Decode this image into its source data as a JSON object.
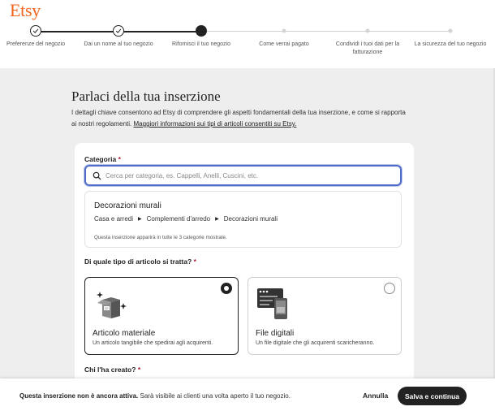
{
  "brand": {
    "logo": "Etsy",
    "color": "#f1641e"
  },
  "steps": [
    {
      "label": "Preferenze del negozio",
      "state": "done"
    },
    {
      "label": "Dai un nome al tuo negozio",
      "state": "done"
    },
    {
      "label": "Rifornisci il tuo negozio",
      "state": "current"
    },
    {
      "label": "Come verrai pagato",
      "state": "todo"
    },
    {
      "label": "Condividi i tuoi dati per la fatturazione",
      "state": "todo"
    },
    {
      "label": "La sicurezza del tuo negozio",
      "state": "todo"
    }
  ],
  "page": {
    "title": "Parlaci della tua inserzione",
    "description": "I dettagli chiave consentono ad Etsy di comprendere gli aspetti fondamentali della tua inserzione, e come si rapporta ai nostri regolamenti.",
    "link": "Maggiori informazioni sui tipi di articoli consentiti su Etsy."
  },
  "category": {
    "label": "Categoria",
    "required_mark": "*",
    "search_placeholder": "Cerca per categoria, es. Cappelli, Anelli, Cuscini, etc.",
    "selected": {
      "title": "Decorazioni murali",
      "path": [
        "Casa e arredi",
        "Complementi d'arredo",
        "Decorazioni murali"
      ],
      "note": "Questa inserzione apparirà in tutte le 3 categorie mostrate."
    }
  },
  "item_type": {
    "label": "Di quale tipo di articolo si tratta?",
    "required_mark": "*",
    "options": [
      {
        "title": "Articolo materiale",
        "desc": "Un articolo tangibile che spedirai agli acquirenti.",
        "selected": true,
        "icon": "package-icon"
      },
      {
        "title": "File digitali",
        "desc": "Un file digitale che gli acquirenti scaricheranno.",
        "selected": false,
        "icon": "digital-files-icon"
      }
    ]
  },
  "creator": {
    "label": "Chi l'ha creato?",
    "required_mark": "*"
  },
  "footer": {
    "notice_bold": "Questa inserzione non è ancora attiva.",
    "notice_rest": "Sarà visibile ai clienti una volta aperto il tuo negozio.",
    "cancel": "Annulla",
    "save": "Salva e continua"
  },
  "colors": {
    "accent_focus": "#4d6bc6",
    "required": "#a61a2e",
    "dark": "#222222",
    "background": "#eeeeee"
  }
}
